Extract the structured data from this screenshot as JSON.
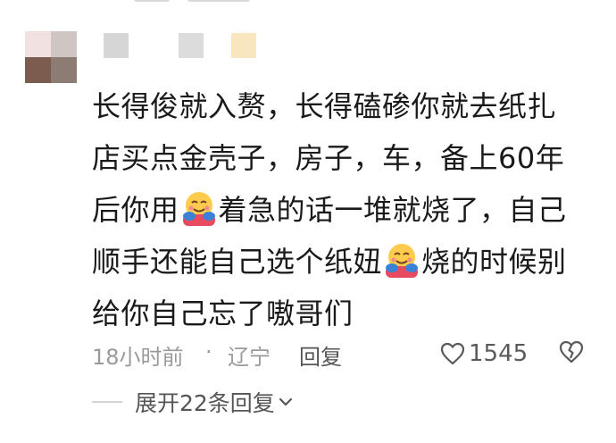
{
  "comment": {
    "lines": [
      [
        "长得俊就入赘，长得磕碜你就去纸扎"
      ],
      [
        "店买点金壳子，房子，车，备上60年"
      ],
      [
        "后你用",
        "着急的话一堆就烧了，自己"
      ],
      [
        "顺手还能自己选个纸妞",
        "烧的时候别"
      ],
      [
        "给你自己忘了嗷哥们"
      ]
    ],
    "emoji_name": "hugging-face-emoji"
  },
  "meta": {
    "time": "18小时前",
    "separator": "·",
    "location": "辽宁",
    "reply_label": "回复",
    "like_count": "1545"
  },
  "replies": {
    "expand_label": "展开22条回复"
  },
  "colors": {
    "text": "#1a1a1a",
    "meta_gray": "#9a9a9a",
    "action_gray": "#555555"
  }
}
